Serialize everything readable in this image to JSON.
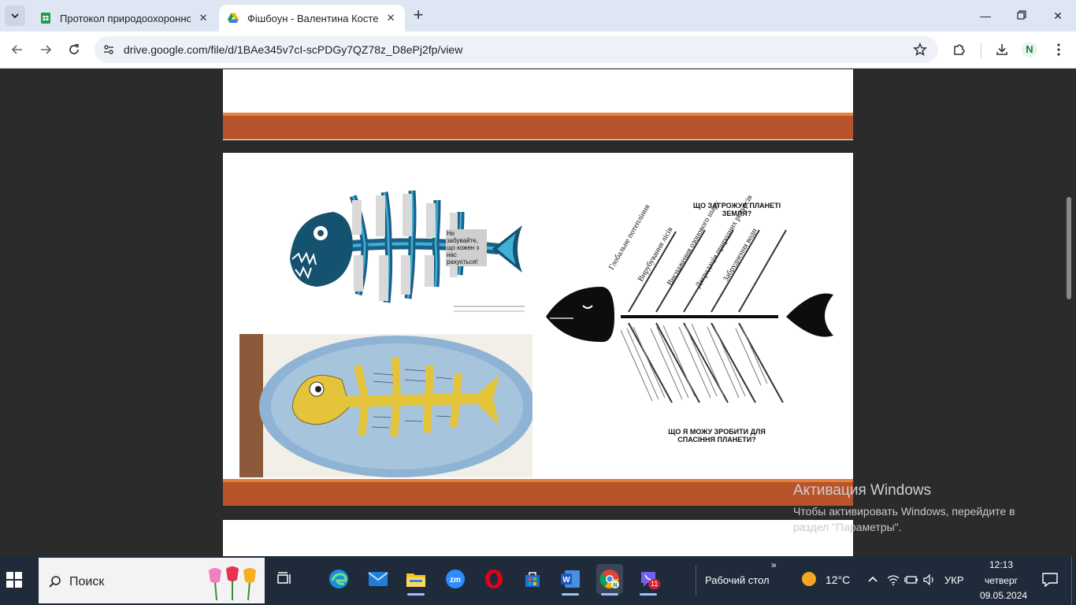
{
  "browser": {
    "tabs": [
      {
        "title": "Протокол природоохоронної",
        "active": false
      },
      {
        "title": "Фішбоун - Валентина Костенк",
        "active": true
      }
    ],
    "url": "drive.google.com/file/d/1BAe345v7cI-scPDGy7QZ78z_D8ePj2fp/view",
    "profile_initial": "N"
  },
  "slide": {
    "fish1_note": "Не забувайте, що кожен з нас рахується!",
    "fish2_top": "ЩО ЗАГРОЖУЄ ПЛАНЕТІ ЗЕМЛЯ?",
    "fish2_bottom": "ЩО Я МОЖУ ЗРОБИТИ ДЛЯ СПАСІННЯ ПЛАНЕТИ?",
    "fish2_bones": [
      "Глобальне потепління",
      "Вирубування лісів",
      "Виснаження озонового шару",
      "Деградація природних ресурсів",
      "Забруднення води"
    ]
  },
  "activation": {
    "title": "Активация Windows",
    "text": "Чтобы активировать Windows, перейдите в раздел \"Параметры\"."
  },
  "taskbar": {
    "search_label": "Поиск",
    "desktop_label": "Рабочий стол",
    "temperature": "12°C",
    "language": "УКР",
    "time": "12:13",
    "weekday": "четверг",
    "date": "09.05.2024",
    "viber_badge": "11"
  },
  "colors": {
    "band": "#b8542b",
    "band_top": "#e8803a",
    "taskbar": "#1f2a3a",
    "tabstrip": "#dfe6f3"
  }
}
